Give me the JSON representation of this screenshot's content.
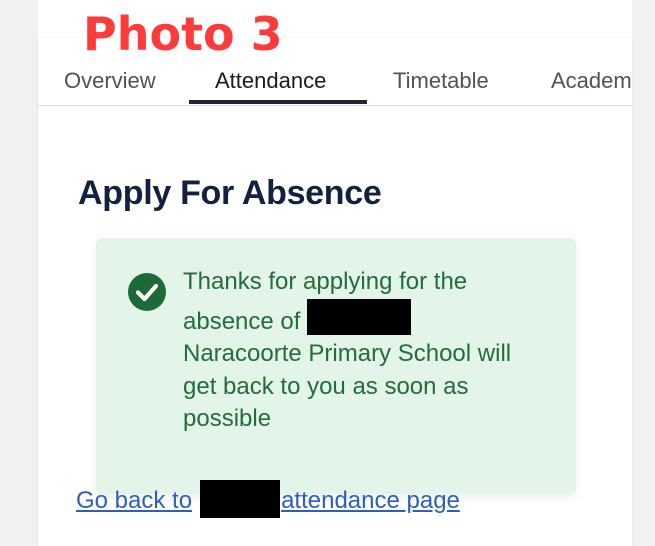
{
  "overlay": {
    "label": "Photo 3"
  },
  "tabs": [
    {
      "label": "Overview",
      "active": false
    },
    {
      "label": "Attendance",
      "active": true
    },
    {
      "label": "Timetable",
      "active": false
    },
    {
      "label": "Academ",
      "active": false
    }
  ],
  "page": {
    "title": "Apply For Absence"
  },
  "alert": {
    "icon": "check-circle-icon",
    "text_before": "Thanks for applying for the absence of",
    "text_after": "Naracoorte Primary School will get back to you as soon as possible",
    "background": "#e3f4e9",
    "text_color": "#246b3e"
  },
  "back_link": {
    "prefix": "Go back to",
    "suffix": "attendance page"
  },
  "colors": {
    "accent_link": "#2b60bf",
    "heading": "#13213e",
    "overlay_label": "#fc3b3b"
  }
}
